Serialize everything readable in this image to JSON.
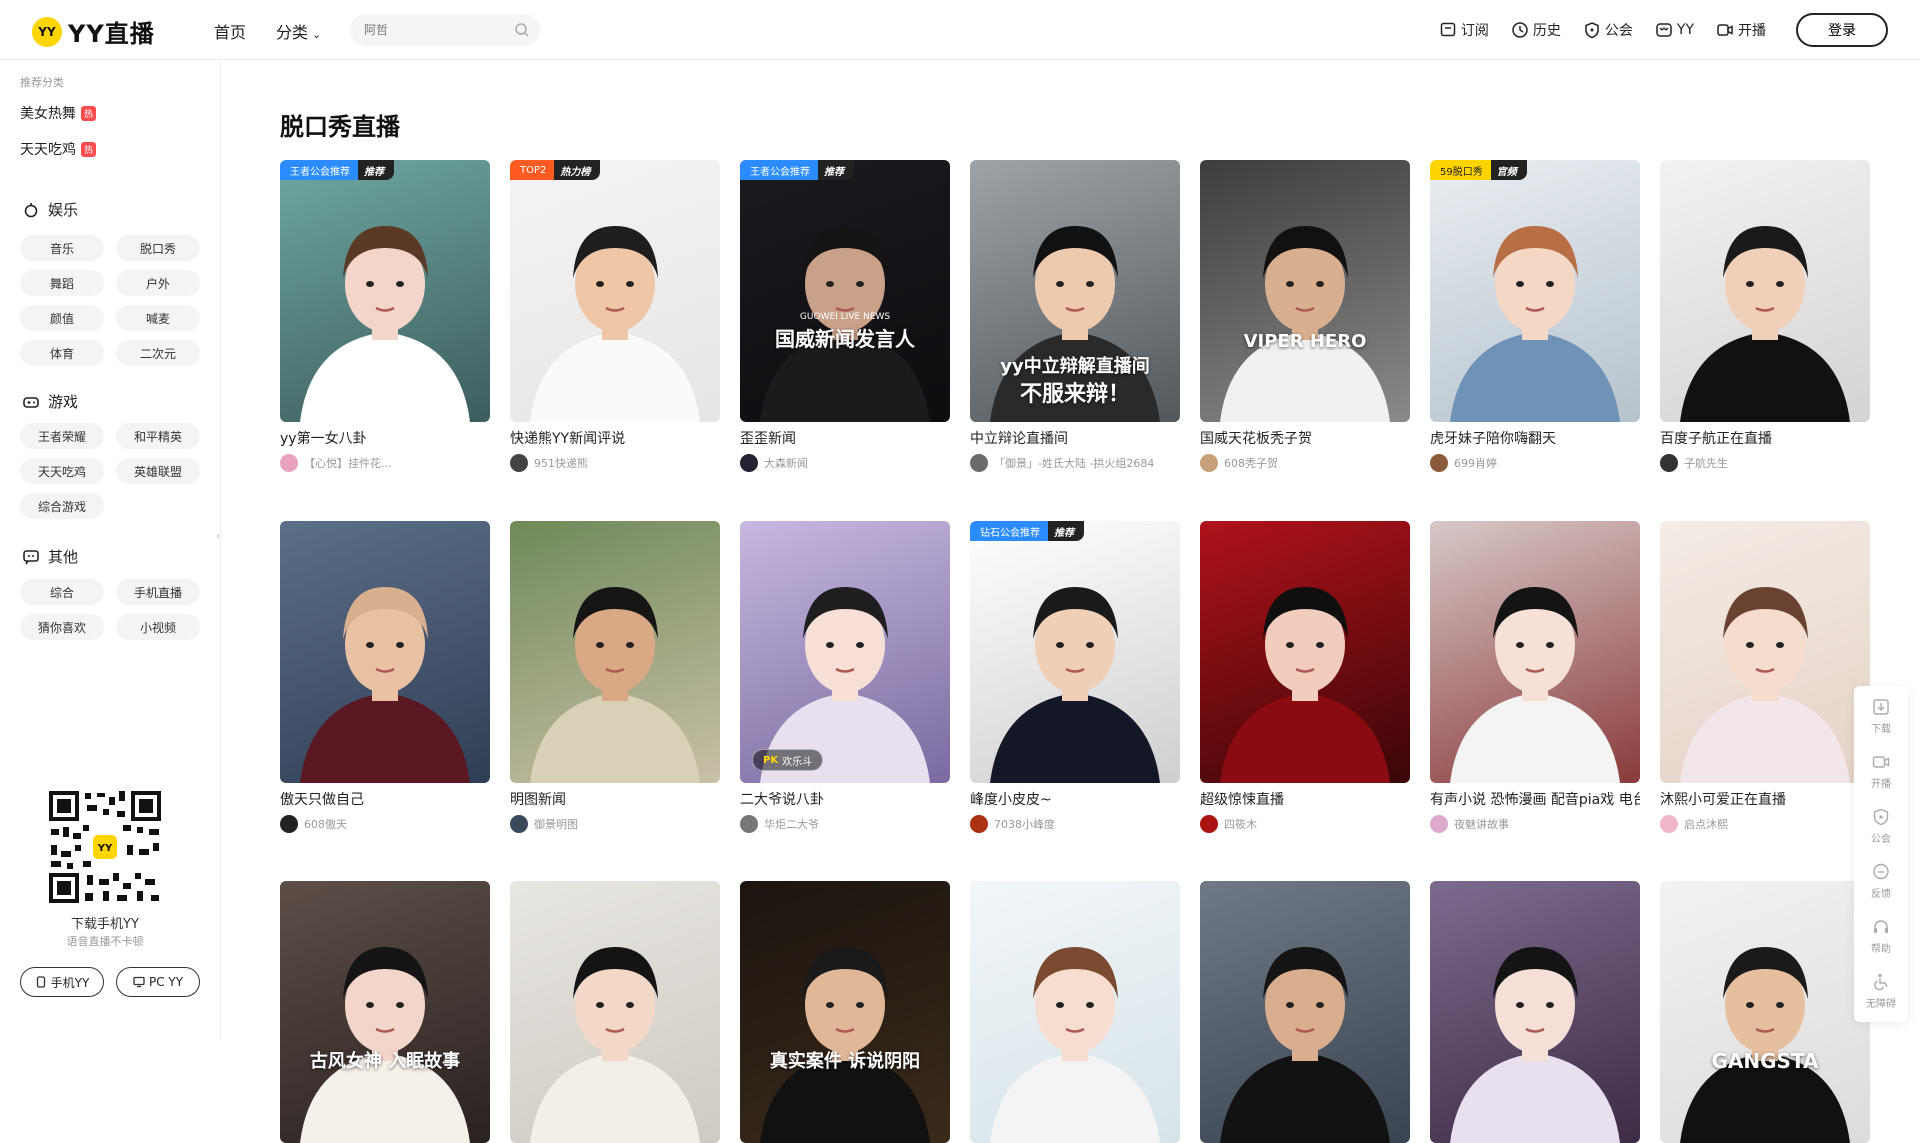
{
  "brand": {
    "badge": "YY",
    "name": "YY直播"
  },
  "nav": {
    "home": "首页",
    "category": "分类"
  },
  "search": {
    "placeholder": "阿哲"
  },
  "top_right": {
    "subscribe": "订阅",
    "history": "历史",
    "guild": "公会",
    "yy": "YY",
    "broadcast": "开播",
    "login": "登录"
  },
  "sidebar": {
    "caption": "推荐分类",
    "recommended": [
      {
        "label": "美女热舞",
        "hot": "热"
      },
      {
        "label": "天天吃鸡",
        "hot": "热"
      }
    ],
    "sections": [
      {
        "title": "娱乐",
        "icon": "entertainment-icon",
        "items": [
          "音乐",
          "脱口秀",
          "舞蹈",
          "户外",
          "颜值",
          "喊麦",
          "体育",
          "二次元"
        ]
      },
      {
        "title": "游戏",
        "icon": "gamepad-icon",
        "items": [
          "王者荣耀",
          "和平精英",
          "天天吃鸡",
          "英雄联盟",
          "综合游戏"
        ]
      },
      {
        "title": "其他",
        "icon": "chat-icon",
        "items": [
          "综合",
          "手机直播",
          "猜你喜欢",
          "小视频"
        ]
      }
    ],
    "qr_badge": "YY",
    "qr_title": "下载手机YY",
    "qr_subtitle": "语音直播不卡顿",
    "mobile_btn": "手机YY",
    "pc_btn": "PC YY"
  },
  "page_title": "脱口秀直播",
  "cards": [
    {
      "title": "yy第一女八卦",
      "streamer": "【心悦】挂件花...",
      "tag1": "王者公会推荐",
      "tag2": "推荐",
      "tagColor": "#2b8cff",
      "bg1": "#6fa7a2",
      "bg2": "#3c5d5d",
      "skin": "#f3d6c9",
      "hair": "#5a3a24",
      "shirt": "#ffffff",
      "av": "#e8a2c0"
    },
    {
      "title": "快递熊YY新闻评说",
      "streamer": "951快递熊",
      "tag1": "TOP2",
      "tag2": "热力榜",
      "tagColor": "#ff5a1f",
      "bg1": "#f4f4f4",
      "bg2": "#e6e6e6",
      "skin": "#f0c7a6",
      "hair": "#1e1e1e",
      "shirt": "#fafafa",
      "av": "#444444"
    },
    {
      "title": "歪歪新闻",
      "streamer": "大森新闻",
      "tag1": "王者公会推荐",
      "tag2": "推荐",
      "tagColor": "#2b8cff",
      "bg1": "#1a1a1f",
      "bg2": "#0d0d10",
      "skin": "#c9a088",
      "hair": "#141414",
      "shirt": "#1b1b1b",
      "av": "#222233",
      "overlay": "国威新闻发言人",
      "overlay_sub": "GUOWEI LIVE NEWS"
    },
    {
      "title": "中立辩论直播间",
      "streamer": "「御景」-姓氏大陆 -拱火组2684",
      "bg1": "#9ea3a8",
      "bg2": "#53585c",
      "skin": "#edc9ae",
      "hair": "#111111",
      "shirt": "#2a2a2a",
      "av": "#6b6b6b",
      "overlay": "yy中立辩解直播间",
      "overlay2": "不服来辩！"
    },
    {
      "title": "国威天花板秃子贺",
      "streamer": "608秃子贺",
      "bg1": "#3d3d3d",
      "bg2": "#8a8a8a",
      "skin": "#d8b08f",
      "hair": "#111111",
      "shirt": "#f1f1f1",
      "av": "#c7a07a",
      "overlay": "VIPER HERO"
    },
    {
      "title": "虎牙妹子陪你嗨翻天",
      "streamer": "699肖婷",
      "tag1": "59脱口秀",
      "tag2": "官频",
      "tagColor": "#ffd500",
      "tagText": "#222222",
      "bg1": "#e9eef2",
      "bg2": "#b6c2cc",
      "skin": "#f5d7c5",
      "hair": "#b86f45",
      "shirt": "#6f93b6",
      "av": "#8a5a3a"
    },
    {
      "title": "百度子航正在直播",
      "streamer": "子航先生",
      "bg1": "#f2f2f2",
      "bg2": "#d4d4d4",
      "skin": "#f0d0b8",
      "hair": "#1a1a1a",
      "shirt": "#111111",
      "av": "#333333"
    },
    {
      "title": "傲天只做自己",
      "streamer": "608傲天",
      "bg1": "#5d6f88",
      "bg2": "#2e3f55",
      "skin": "#e8c2a2",
      "hair": "#d8b08f",
      "shirt": "#5a1822",
      "av": "#222222"
    },
    {
      "title": "明图新闻",
      "streamer": "御景明图",
      "bg1": "#6f8a58",
      "bg2": "#c9c0a8",
      "skin": "#d9a986",
      "hair": "#151515",
      "shirt": "#d9d0b8",
      "av": "#3a4a5a"
    },
    {
      "title": "二大爷说八卦",
      "streamer": "华炬二大爷",
      "bg1": "#c6b8e0",
      "bg2": "#7a6aa0",
      "skin": "#f7dfd6",
      "hair": "#1e1e1e",
      "shirt": "#e8e0ee",
      "av": "#777777",
      "pk": "欢乐斗",
      "pk_mark": "PK"
    },
    {
      "title": "峰度小皮皮~",
      "streamer": "7038小峰度",
      "tag1": "钻石公会推荐",
      "tag2": "推荐",
      "tagColor": "#2b8cff",
      "bg1": "#ffffff",
      "bg2": "#cfcfcf",
      "skin": "#efcfb5",
      "hair": "#1a1a1a",
      "shirt": "#141826",
      "av": "#aa3311"
    },
    {
      "title": "超级惊悚直播",
      "streamer": "四筱木",
      "bg1": "#b0121a",
      "bg2": "#3a0608",
      "skin": "#f2cdbd",
      "hair": "#0f0f0f",
      "shirt": "#8a0c12",
      "av": "#aa1111"
    },
    {
      "title": "有声小说 恐怖漫画 配音pia戏 电台",
      "streamer": "夜魅讲故事",
      "bg1": "#d8c8c8",
      "bg2": "#8a3a3a",
      "skin": "#f7e0d6",
      "hair": "#141414",
      "shirt": "#f4f4f4",
      "av": "#ddaacc"
    },
    {
      "title": "沐熙小可爱正在直播",
      "streamer": "启点沐熙",
      "bg1": "#f4ece6",
      "bg2": "#e4d2c6",
      "skin": "#f6dccd",
      "hair": "#6a4330",
      "shirt": "#f3e6ea",
      "av": "#f0b8c8"
    },
    {
      "title": "",
      "streamer": "",
      "bg1": "#5d4e48",
      "bg2": "#2a2220",
      "skin": "#f3d6c9",
      "hair": "#141414",
      "shirt": "#f6f0ea",
      "av": "#cccccc",
      "overlay": "古风女神 入眠故事"
    },
    {
      "title": "",
      "streamer": "",
      "bg1": "#e8e6e2",
      "bg2": "#cfcac2",
      "skin": "#f3d8c8",
      "hair": "#141414",
      "shirt": "#f2eee8",
      "av": "#cccccc"
    },
    {
      "title": "",
      "streamer": "",
      "bg1": "#1b1410",
      "bg2": "#3a2a1a",
      "skin": "#e0b898",
      "hair": "#1a1a1a",
      "shirt": "#111111",
      "av": "#cccccc",
      "overlay": "真实案件 诉说阴阳"
    },
    {
      "title": "",
      "streamer": "",
      "bg1": "#f2f6f8",
      "bg2": "#d6e4ea",
      "skin": "#f6ddd0",
      "hair": "#7a4b30",
      "shirt": "#f4f4f4",
      "av": "#cccccc"
    },
    {
      "title": "",
      "streamer": "",
      "bg1": "#6f7a86",
      "bg2": "#3a4450",
      "skin": "#d8ae8e",
      "hair": "#141414",
      "shirt": "#121212",
      "av": "#cccccc"
    },
    {
      "title": "",
      "streamer": "",
      "bg1": "#7e6a8e",
      "bg2": "#3c2c46",
      "skin": "#f6dfd6",
      "hair": "#141414",
      "shirt": "#e8e0ee",
      "av": "#cccccc"
    },
    {
      "title": "",
      "streamer": "",
      "bg1": "#f2f2f2",
      "bg2": "#dcdcdc",
      "skin": "#e6bf9f",
      "hair": "#1a1a1a",
      "shirt": "#111111",
      "av": "#cccccc",
      "overlay": "GANGSTA"
    }
  ],
  "right_bar": [
    {
      "label": "下载",
      "icon": "download-icon"
    },
    {
      "label": "开播",
      "icon": "video-icon"
    },
    {
      "label": "公会",
      "icon": "shield-icon"
    },
    {
      "label": "反馈",
      "icon": "feedback-icon"
    },
    {
      "label": "帮助",
      "icon": "headset-icon"
    },
    {
      "label": "无障碍",
      "icon": "accessibility-icon"
    }
  ]
}
